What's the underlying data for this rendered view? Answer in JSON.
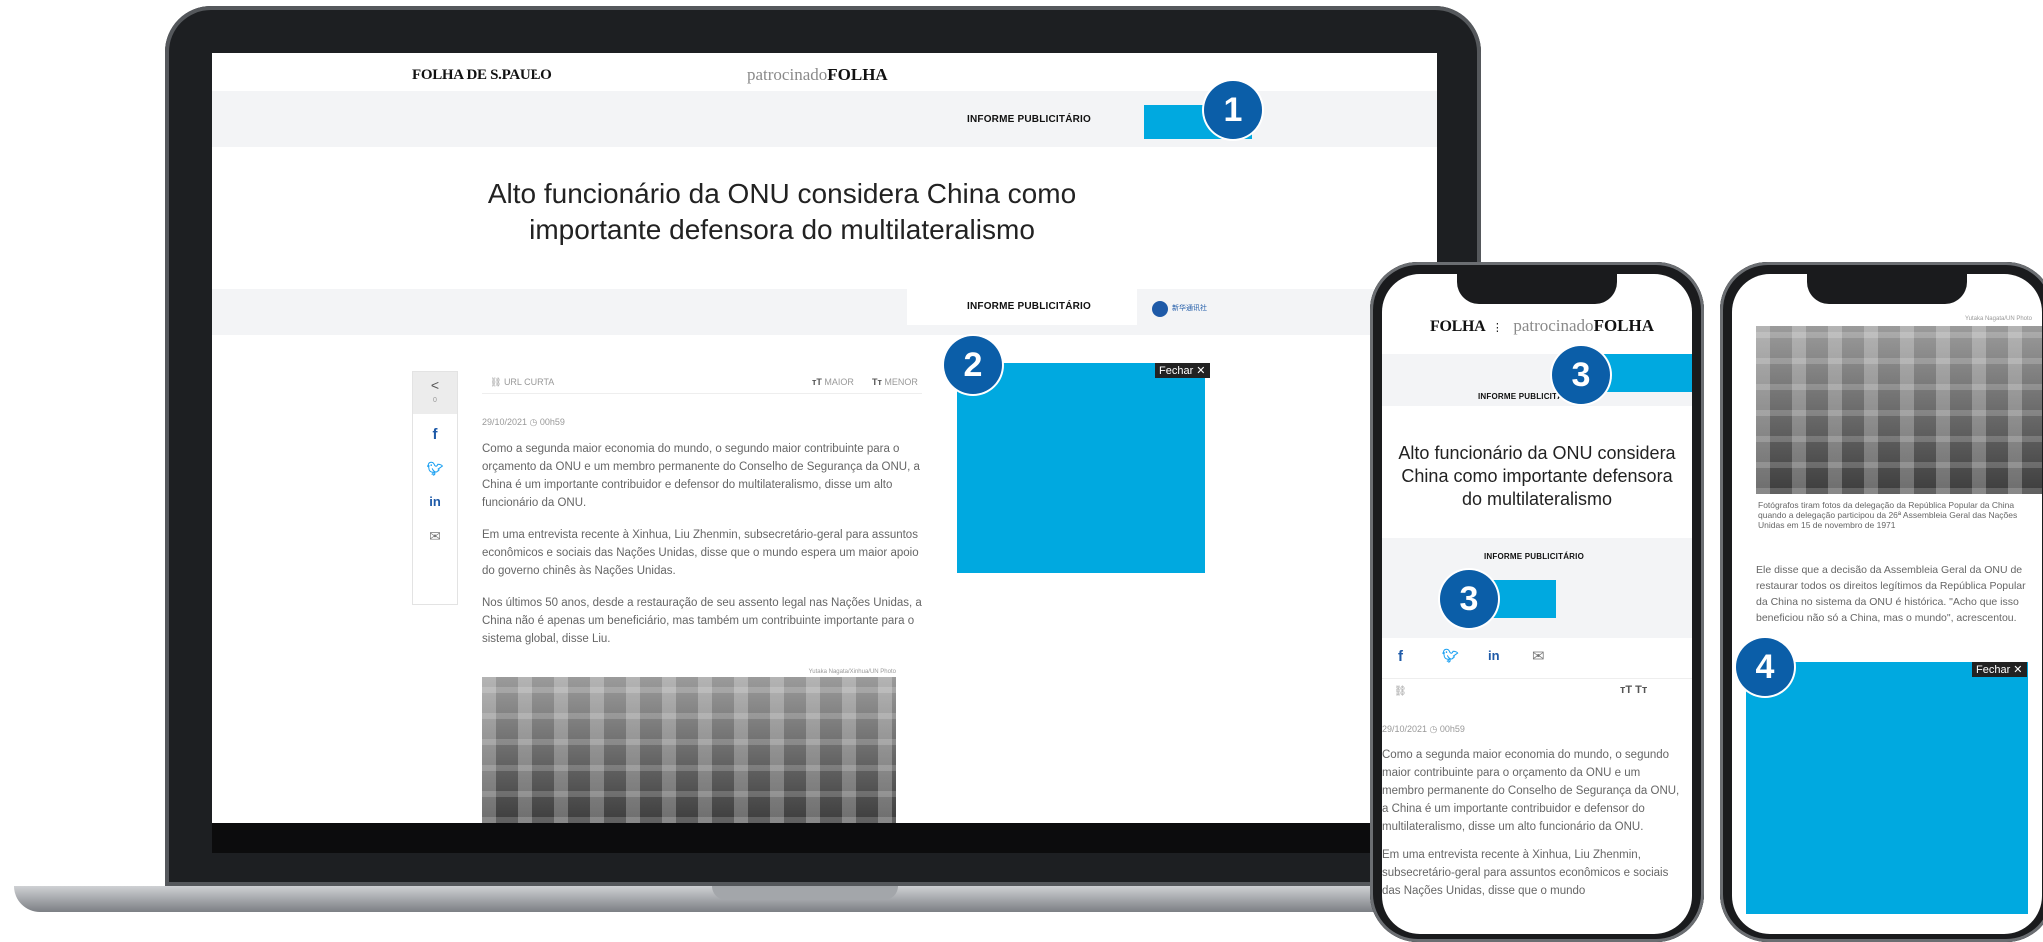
{
  "laptop": {
    "brand_left": "FOLHA DE S.PAULO",
    "brand_right_prefix": "patrocinado",
    "brand_right_suffix": "FOLHA",
    "informe_label": "INFORME PUBLICITÁRIO",
    "headline_line1": "Alto funcionário da ONU considera China como",
    "headline_line2": "importante defensora do multilateralismo",
    "informe_label_2": "INFORME PUBLICITÁRIO",
    "sponsor_text": "新华通讯社",
    "toolbar": {
      "short_url": "URL CURTA",
      "bigger": "MAIOR",
      "smaller": "MENOR"
    },
    "share_count": "0",
    "date": "29/10/2021 ◷ 00h59",
    "paragraphs": [
      "Como a segunda maior economia do mundo, o segundo maior contribuinte para o orçamento da ONU e um membro permanente do Conselho de Segurança da ONU, a China é um importante contribuidor e defensor do multilateralismo, disse um alto funcionário da ONU.",
      "Em uma entrevista recente à Xinhua, Liu Zhenmin, subsecretário-geral para assuntos econômicos e sociais das Nações Unidas, disse que o mundo espera um maior apoio do governo chinês às Nações Unidas.",
      "Nos últimos 50 anos, desde a restauração de seu assento legal nas Nações Unidas, a China não é apenas um beneficiário, mas também um contribuinte importante para o sistema global, disse Liu."
    ],
    "photo_credit": "Yutaka Nagata/Xinhua/UN Photo",
    "ad_close": "Fechar ✕",
    "badge_1": "1",
    "badge_2": "2"
  },
  "phone1": {
    "brand_left": "FOLHA",
    "brand_right_prefix": "patrocinado",
    "brand_right_suffix": "FOLHA",
    "informe_label": "INFORME PUBLICITÁRIO",
    "headline": "Alto funcionário da ONU considera China como importante defensora do multilateralismo",
    "informe_label_2": "INFORME PUBLICITÁRIO",
    "date": "29/10/2021 ◷ 00h59",
    "paragraph1": "Como a segunda maior economia do mundo, o segundo maior contribuinte para o orçamento da ONU e um membro permanente do Conselho de Segurança da ONU, a China é um importante contribuidor e defensor do multilateralismo, disse um alto funcionário da ONU.",
    "paragraph2": "Em uma entrevista recente à Xinhua, Liu Zhenmin, subsecretário-geral para assuntos econômicos e sociais das Nações Unidas, disse que o mundo",
    "badge_top": "3",
    "badge_mid": "3"
  },
  "phone2": {
    "photo_credit": "Yutaka Nagata/UN Photo",
    "caption": "Fotógrafos tiram fotos da delegação da República Popular da China quando a delegação participou da 26ª Assembleia Geral das Nações Unidas em 15 de novembro de 1971",
    "paragraph": "Ele disse que a decisão da Assembleia Geral da ONU de restaurar todos os direitos legítimos da República Popular da China no sistema da ONU é histórica. \"Acho que isso beneficiou não só a China, mas o mundo\", acrescentou.",
    "ad_close": "Fechar ✕",
    "badge": "4"
  },
  "colors": {
    "ad_blue": "#00a9e0",
    "badge_blue": "#0b5ea8",
    "share_blue": "#1e5aa8"
  }
}
